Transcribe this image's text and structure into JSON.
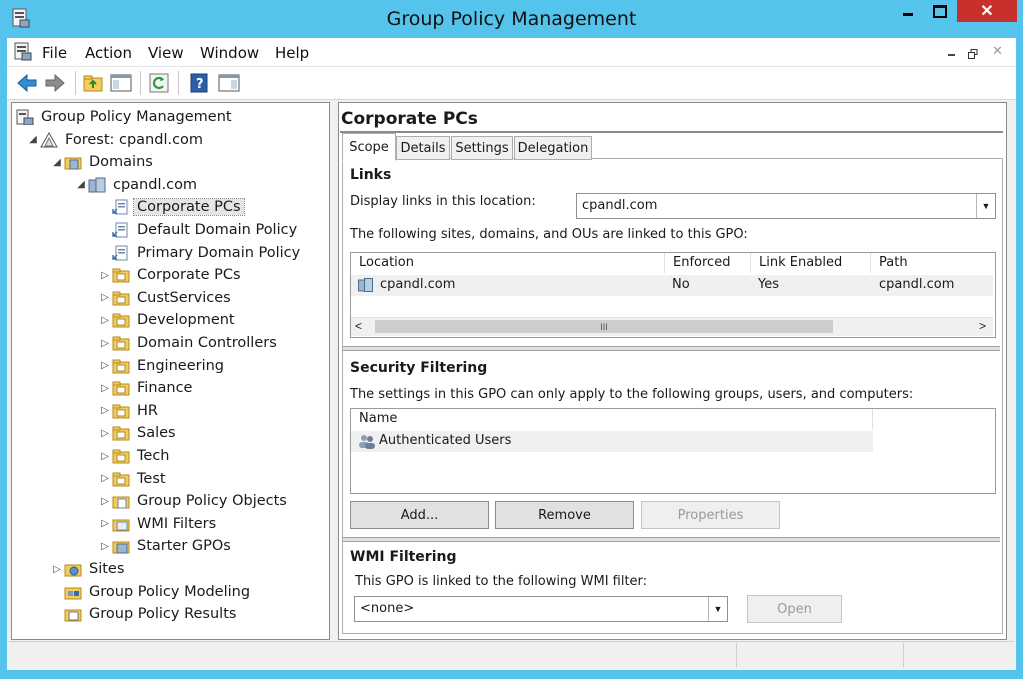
{
  "window": {
    "title": "Group Policy Management"
  },
  "menu": [
    "File",
    "Action",
    "View",
    "Window",
    "Help"
  ],
  "toolbar_icons": [
    "back-arrow-icon",
    "forward-arrow-icon",
    "folder-up-icon",
    "show-hide-console-tree-icon",
    "refresh-icon",
    "help-icon",
    "show-action-pane-icon"
  ],
  "tree": [
    {
      "label": "Group Policy Management",
      "icon": "gpm-console-icon",
      "level": 0,
      "arrow": ""
    },
    {
      "label": "Forest: cpandl.com",
      "icon": "forest-icon",
      "level": 1,
      "arrow": "expanded"
    },
    {
      "label": "Domains",
      "icon": "domains-icon",
      "level": 2,
      "arrow": "expanded"
    },
    {
      "label": "cpandl.com",
      "icon": "domain-icon",
      "level": 3,
      "arrow": "expanded"
    },
    {
      "label": "Corporate PCs",
      "icon": "gpo-link-icon",
      "level": 4,
      "arrow": "",
      "selected": true
    },
    {
      "label": "Default Domain Policy",
      "icon": "gpo-link-icon",
      "level": 4,
      "arrow": ""
    },
    {
      "label": "Primary Domain Policy",
      "icon": "gpo-link-icon",
      "level": 4,
      "arrow": ""
    },
    {
      "label": "Corporate PCs",
      "icon": "ou-folder-icon",
      "level": 4,
      "arrow": "collapsed"
    },
    {
      "label": "CustServices",
      "icon": "ou-folder-icon",
      "level": 4,
      "arrow": "collapsed"
    },
    {
      "label": "Development",
      "icon": "ou-folder-icon",
      "level": 4,
      "arrow": "collapsed"
    },
    {
      "label": "Domain Controllers",
      "icon": "ou-folder-icon",
      "level": 4,
      "arrow": "collapsed"
    },
    {
      "label": "Engineering",
      "icon": "ou-folder-icon",
      "level": 4,
      "arrow": "collapsed"
    },
    {
      "label": "Finance",
      "icon": "ou-folder-icon",
      "level": 4,
      "arrow": "collapsed"
    },
    {
      "label": "HR",
      "icon": "ou-folder-icon",
      "level": 4,
      "arrow": "collapsed"
    },
    {
      "label": "Sales",
      "icon": "ou-folder-icon",
      "level": 4,
      "arrow": "collapsed"
    },
    {
      "label": "Tech",
      "icon": "ou-folder-icon",
      "level": 4,
      "arrow": "collapsed"
    },
    {
      "label": "Test",
      "icon": "ou-folder-icon",
      "level": 4,
      "arrow": "collapsed"
    },
    {
      "label": "Group Policy Objects",
      "icon": "gpo-container-icon",
      "level": 4,
      "arrow": "collapsed"
    },
    {
      "label": "WMI Filters",
      "icon": "wmi-filters-icon",
      "level": 4,
      "arrow": "collapsed"
    },
    {
      "label": "Starter GPOs",
      "icon": "starter-gpos-icon",
      "level": 4,
      "arrow": "collapsed"
    },
    {
      "label": "Sites",
      "icon": "sites-icon",
      "level": 2,
      "arrow": "collapsed"
    },
    {
      "label": "Group Policy Modeling",
      "icon": "modeling-icon",
      "level": 2,
      "arrow": ""
    },
    {
      "label": "Group Policy Results",
      "icon": "results-icon",
      "level": 2,
      "arrow": ""
    }
  ],
  "details": {
    "title": "Corporate PCs",
    "tabs": [
      "Scope",
      "Details",
      "Settings",
      "Delegation"
    ],
    "active_tab": "Scope",
    "links": {
      "heading": "Links",
      "location_label": "Display links in this location:",
      "location_value": "cpandl.com",
      "list_label": "The following sites, domains, and OUs are linked to this GPO:",
      "columns": [
        "Location",
        "Enforced",
        "Link Enabled",
        "Path"
      ],
      "rows": [
        [
          "cpandl.com",
          "No",
          "Yes",
          "cpandl.com"
        ]
      ]
    },
    "security": {
      "heading": "Security Filtering",
      "description": "The settings in this GPO can only apply to the following groups, users, and computers:",
      "column": "Name",
      "rows": [
        "Authenticated Users"
      ],
      "buttons": {
        "add": "Add...",
        "remove": "Remove",
        "properties": "Properties"
      }
    },
    "wmi": {
      "heading": "WMI Filtering",
      "description": "This GPO is linked to the following WMI filter:",
      "value": "<none>",
      "open_label": "Open"
    }
  },
  "scroll_thumb_glyph": "III"
}
